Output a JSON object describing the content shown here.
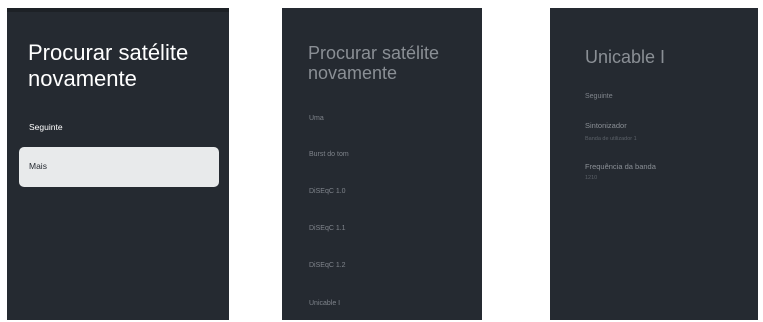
{
  "panel1": {
    "title": "Procurar satélite novamente",
    "next_label": "Seguinte",
    "more_label": "Mais"
  },
  "panel2": {
    "title": "Procurar satélite novamente",
    "options": [
      "Uma",
      "Burst do tom",
      "DiSEqC 1.0",
      "DiSEqC 1.1",
      "DiSEqC 1.2",
      "Unicable I"
    ]
  },
  "panel3": {
    "title": "Unicable I",
    "next_label": "Seguinte",
    "tuner_label": "Sintonizador",
    "tuner_value": "Banda de utilizador 1",
    "freq_label": "Frequência da banda",
    "freq_value": "1210"
  },
  "colors": {
    "panel_bg": "#252a31",
    "selected_bg": "#e8eaeb",
    "text_primary": "#ffffff",
    "text_dim": "#7f848b"
  }
}
